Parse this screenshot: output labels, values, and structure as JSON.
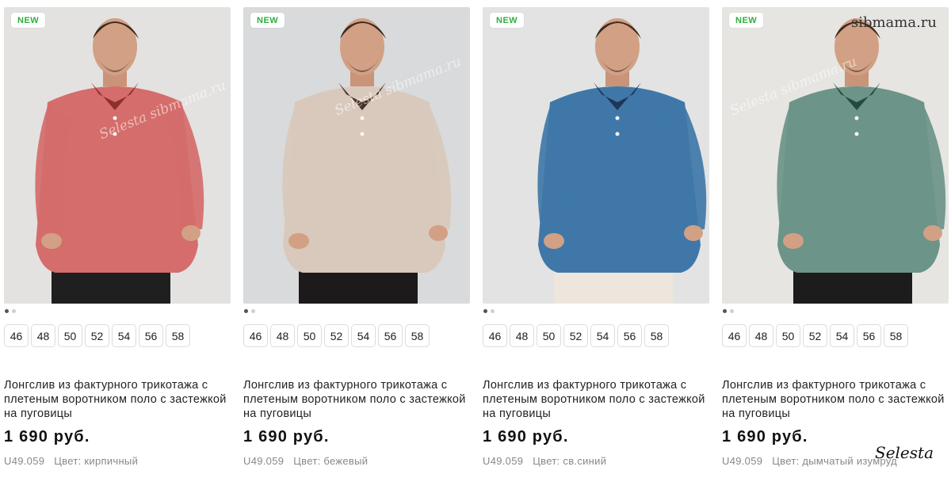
{
  "products": [
    {
      "badge": "NEW",
      "sizes": [
        "46",
        "48",
        "50",
        "52",
        "54",
        "56",
        "58"
      ],
      "title": "Лонгслив из фактурного трикотажа с плетеным воротником поло с застежкой на пуговицы",
      "price": "1 690 руб.",
      "sku": "U49.059",
      "color_label": "Цвет: кирпичный",
      "shirt_color": "#d46d6b",
      "collar_color": "#8e2e2e",
      "bg_color": "#e3e2e0",
      "pants_color": "#1f1f1f"
    },
    {
      "badge": "NEW",
      "sizes": [
        "46",
        "48",
        "50",
        "52",
        "54",
        "56",
        "58"
      ],
      "title": "Лонгслив из фактурного трикотажа с плетеным воротником поло с застежкой на пуговицы",
      "price": "1 690 руб.",
      "sku": "U49.059",
      "color_label": "Цвет: бежевый",
      "shirt_color": "#d9c9bc",
      "collar_color": "#4a3228",
      "bg_color": "#d8dadb",
      "pants_color": "#1c1a1a"
    },
    {
      "badge": "NEW",
      "sizes": [
        "46",
        "48",
        "50",
        "52",
        "54",
        "56",
        "58"
      ],
      "title": "Лонгслив из фактурного трикотажа с плетеным воротником поло с застежкой на пуговицы",
      "price": "1 690 руб.",
      "sku": "U49.059",
      "color_label": "Цвет: св.синий",
      "shirt_color": "#3f78a8",
      "collar_color": "#1f3558",
      "bg_color": "#e2e3e2",
      "pants_color": "#ece6dc"
    },
    {
      "badge": "NEW",
      "sizes": [
        "46",
        "48",
        "50",
        "52",
        "54",
        "56",
        "58"
      ],
      "title": "Лонгслив из фактурного трикотажа с плетеным воротником поло с застежкой на пуговицы",
      "price": "1 690 руб.",
      "sku": "U49.059",
      "color_label": "Цвет: дымчатый изумруд",
      "shirt_color": "#6c9488",
      "collar_color": "#244a3e",
      "bg_color": "#e6e5e2",
      "pants_color": "#1c1c1c"
    }
  ],
  "watermarks": {
    "site": "sibmama.ru",
    "brand": "Selesta",
    "photo": "Selesta sibmama.ru"
  }
}
